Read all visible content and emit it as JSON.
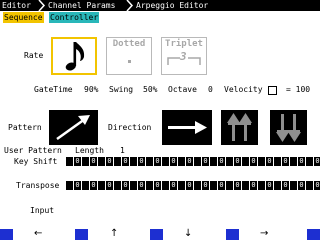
{
  "breadcrumb": [
    "Editor",
    "Channel Params",
    "Arpeggio Editor"
  ],
  "tabs": [
    {
      "label": "Sequence",
      "color": "#f2c400"
    },
    {
      "label": "Controller",
      "color": "#29b7b9"
    }
  ],
  "rate": {
    "label": "Rate",
    "options": [
      {
        "name": "quarter",
        "selected": true
      },
      {
        "name": "Dotted",
        "selected": false
      },
      {
        "name": "Triplet",
        "selected": false,
        "marker": "3"
      }
    ]
  },
  "params": {
    "gatetime_label": "GateTime",
    "gatetime_value": "90%",
    "swing_label": "Swing",
    "swing_value": "50%",
    "octave_label": "Octave",
    "octave_value": "0",
    "velocity_label": "Velocity",
    "velocity_value": "= 100",
    "velocity_checked": false
  },
  "pattern": {
    "label": "Pattern",
    "direction_label": "Direction",
    "icons": [
      "up-right-arrow-icon",
      "right-arrow-icon",
      "double-up-arrow-icon",
      "double-down-arrow-icon"
    ]
  },
  "user_pattern": {
    "label": "User Pattern",
    "length_label": "Length",
    "length_value": "1",
    "key_shift_label": "Key Shift",
    "key_shift": [
      "0",
      "0",
      "0",
      "0",
      "0",
      "0",
      "0",
      "0",
      "0",
      "0",
      "0",
      "0",
      "0",
      "0",
      "0",
      "0"
    ],
    "transpose_label": "Transpose",
    "transpose": [
      "0",
      "0",
      "0",
      "0",
      "0",
      "0",
      "0",
      "0",
      "0",
      "0",
      "0",
      "0",
      "0",
      "0",
      "0",
      "0"
    ]
  },
  "input_label": "Input",
  "nav": {
    "left": "←",
    "up": "↑",
    "down": "↓",
    "right": "→",
    "accent": "#1d2fd1"
  }
}
